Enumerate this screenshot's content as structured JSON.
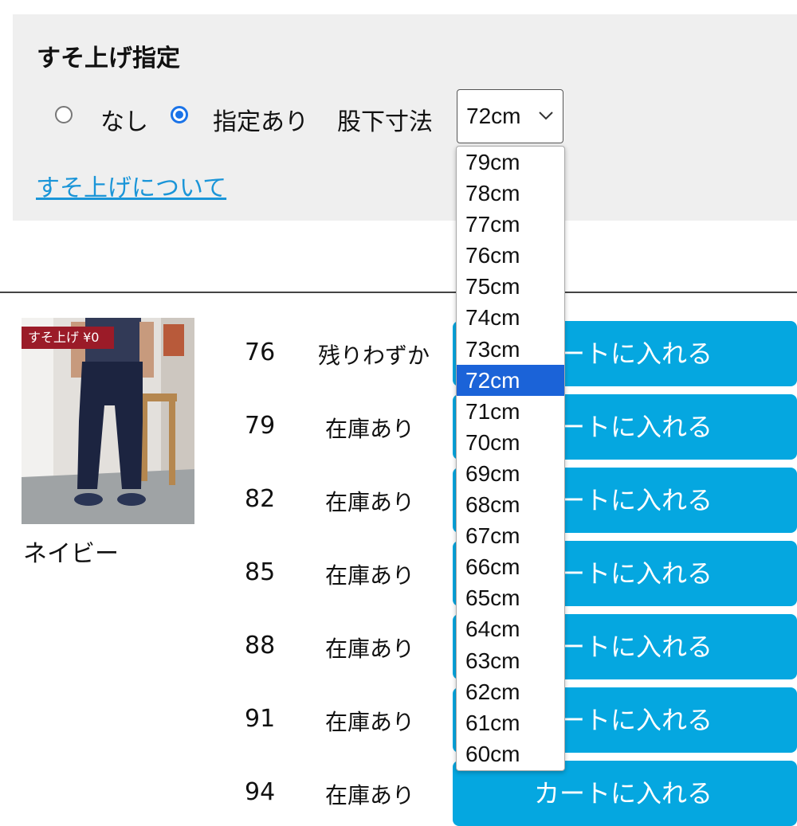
{
  "hem": {
    "title": "すそ上げ指定",
    "option_none": "なし",
    "option_specify": "指定あり",
    "inseam_label": "股下寸法",
    "selected_inseam": "72cm",
    "link": "すそ上げについて",
    "selected_option": "指定あり"
  },
  "dropdown": {
    "options": [
      "79cm",
      "78cm",
      "77cm",
      "76cm",
      "75cm",
      "74cm",
      "73cm",
      "72cm",
      "71cm",
      "70cm",
      "69cm",
      "68cm",
      "67cm",
      "66cm",
      "65cm",
      "64cm",
      "63cm",
      "62cm",
      "61cm",
      "60cm"
    ],
    "selected": "72cm"
  },
  "product": {
    "badge": "すそ上げ ¥0",
    "color_name": "ネイビー"
  },
  "rows": [
    {
      "size": "76",
      "stock": "残りわずか",
      "button": "カートに入れる"
    },
    {
      "size": "79",
      "stock": "在庫あり",
      "button": "カートに入れる"
    },
    {
      "size": "82",
      "stock": "在庫あり",
      "button": "カートに入れる"
    },
    {
      "size": "85",
      "stock": "在庫あり",
      "button": "カートに入れる"
    },
    {
      "size": "88",
      "stock": "在庫あり",
      "button": "カートに入れる"
    },
    {
      "size": "91",
      "stock": "在庫あり",
      "button": "カートに入れる"
    },
    {
      "size": "94",
      "stock": "在庫あり",
      "button": "カートに入れる"
    }
  ],
  "colors": {
    "accent": "#05a7e0",
    "link": "#1a95d8",
    "radio": "#1a73e8",
    "badge": "#9b1b28",
    "dropdown_highlight": "#1b63d8"
  }
}
